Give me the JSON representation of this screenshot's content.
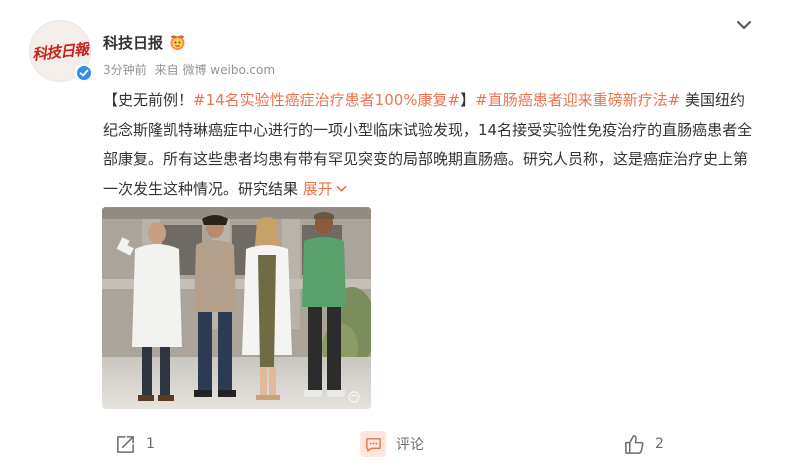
{
  "post": {
    "avatar_text": "科技日報",
    "username": "科技日报",
    "time": "3分钟前",
    "source_prefix": "来自",
    "source": "微博 weibo.com",
    "content": {
      "lead": "【史无前例！",
      "tag1": "#14名实验性癌症治疗患者100%康复#",
      "mid": "】",
      "tag2": "#直肠癌患者迎来重磅新疗法#",
      "body": " 美国纽约纪念斯隆凯特琳癌症中心进行的一项小型临床试验发现，14名接受实验性免疫治疗的直肠癌患者全部康复。所有这些患者均患有带有罕见突变的局部晚期直肠癌。研究人员称，这是癌症治疗史上第一次发生这种情况。研究结果 ",
      "expand": "展开"
    },
    "actions": {
      "forward_count": "1",
      "comment_label": "评论",
      "like_count": "2"
    }
  },
  "colors": {
    "accent": "#eb7350",
    "text": "#333333",
    "muted": "#939393",
    "verified": "#2f8ff0"
  },
  "icons": {
    "collapse": "chevron-down-icon",
    "forward": "share-icon",
    "comment": "comment-icon",
    "like": "thumbs-up-icon",
    "verified": "verified-badge-icon",
    "user_badge": "fan-badge-icon"
  }
}
